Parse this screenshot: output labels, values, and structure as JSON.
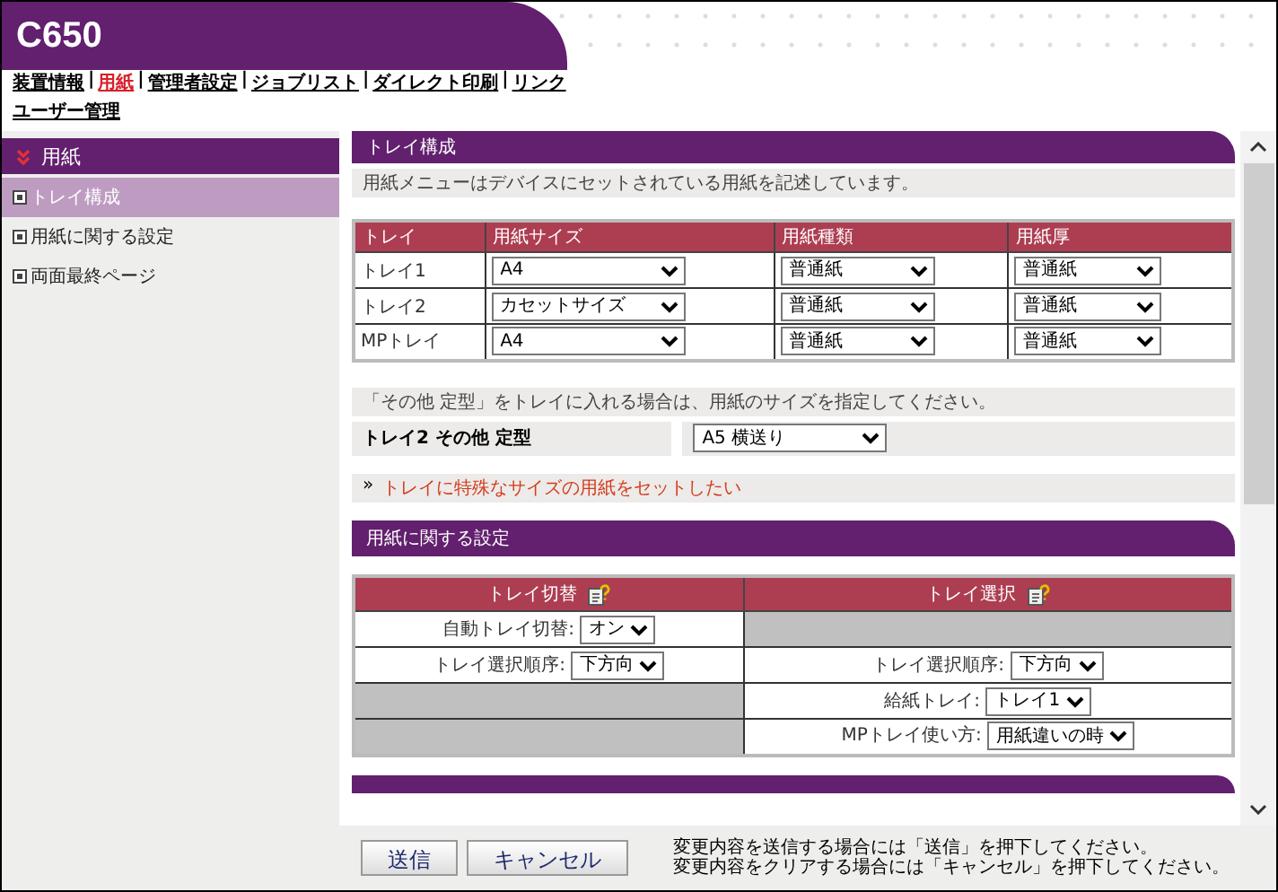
{
  "header": {
    "title": "C650"
  },
  "nav_separator": "|",
  "nav": [
    {
      "label": "装置情報",
      "selected": false
    },
    {
      "label": "用紙",
      "selected": true
    },
    {
      "label": "管理者設定",
      "selected": false
    },
    {
      "label": "ジョブリスト",
      "selected": false
    },
    {
      "label": "ダイレクト印刷",
      "selected": false
    },
    {
      "label": "リンク",
      "selected": false
    },
    {
      "label": "ユーザー管理",
      "selected": false
    }
  ],
  "sidebar": {
    "title": "用紙",
    "items": [
      {
        "label": "トレイ構成",
        "selected": true
      },
      {
        "label": "用紙に関する設定",
        "selected": false
      },
      {
        "label": "両面最終ページ",
        "selected": false
      }
    ]
  },
  "tray_section": {
    "title": "トレイ構成",
    "description": "用紙メニューはデバイスにセットされている用紙を記述しています。",
    "columns": [
      "トレイ",
      "用紙サイズ",
      "用紙種類",
      "用紙厚"
    ],
    "rows": [
      {
        "tray": "トレイ1",
        "size": "A4",
        "type": "普通紙",
        "weight": "普通紙"
      },
      {
        "tray": "トレイ2",
        "size": "カセットサイズ",
        "type": "普通紙",
        "weight": "普通紙"
      },
      {
        "tray": "MPトレイ",
        "size": "A4",
        "type": "普通紙",
        "weight": "普通紙"
      }
    ],
    "note": "「その他 定型」をトレイに入れる場合は、用紙のサイズを指定してください。",
    "other_size": {
      "label": "トレイ2 その他 定型",
      "value": "A5 横送り"
    },
    "link": {
      "marker": "»",
      "label": "トレイに特殊なサイズの用紙をセットしたい"
    }
  },
  "paper_section": {
    "title": "用紙に関する設定",
    "columns": [
      "トレイ切替",
      "トレイ選択"
    ],
    "rows": [
      [
        {
          "kind": "select",
          "label": "自動トレイ切替:",
          "value": "オン"
        },
        {
          "kind": "empty"
        }
      ],
      [
        {
          "kind": "select",
          "label": "トレイ選択順序:",
          "value": "下方向"
        },
        {
          "kind": "select",
          "label": "トレイ選択順序:",
          "value": "下方向"
        }
      ],
      [
        {
          "kind": "empty"
        },
        {
          "kind": "select",
          "label": "給紙トレイ:",
          "value": "トレイ1"
        }
      ],
      [
        {
          "kind": "empty"
        },
        {
          "kind": "select",
          "label": "MPトレイ使い方:",
          "value": "用紙違いの時"
        }
      ]
    ]
  },
  "footer": {
    "buttons": [
      "送信",
      "キャンセル"
    ],
    "notes": [
      "変更内容を送信する場合には「送信」を押下してください。",
      "変更内容をクリアする場合には「キャンセル」を押下してください。"
    ]
  }
}
